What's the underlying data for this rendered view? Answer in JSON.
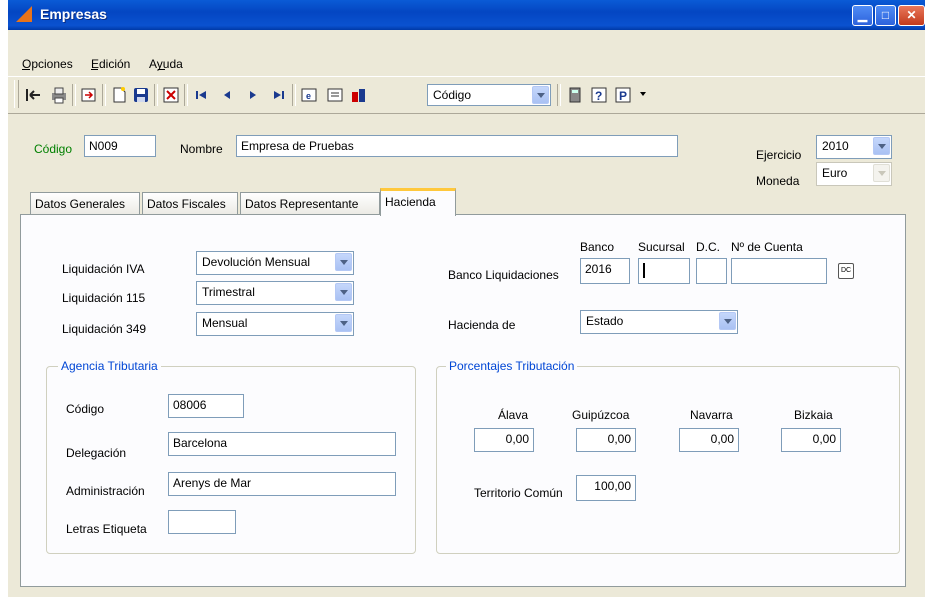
{
  "window": {
    "title": "Empresas"
  },
  "menu": {
    "items": [
      "Opciones",
      "Edición",
      "Ayuda"
    ]
  },
  "toolbar": {
    "search_field_value": "Código"
  },
  "header": {
    "codigo_label": "Código",
    "codigo_value": "N009",
    "nombre_label": "Nombre",
    "nombre_value": "Empresa de Pruebas",
    "ejercicio_label": "Ejercicio",
    "ejercicio_value": "2010",
    "moneda_label": "Moneda",
    "moneda_value": "Euro"
  },
  "tabs": [
    "Datos Generales",
    "Datos Fiscales",
    "Datos Representante",
    "Hacienda"
  ],
  "hacienda": {
    "liq_iva_label": "Liquidación IVA",
    "liq_iva_value": "Devolución Mensual",
    "liq_115_label": "Liquidación 115",
    "liq_115_value": "Trimestral",
    "liq_349_label": "Liquidación 349",
    "liq_349_value": "Mensual",
    "banco_header": "Banco",
    "sucursal_header": "Sucursal",
    "dc_header": "D.C.",
    "cuenta_header": "Nº de Cuenta",
    "banco_liq_label": "Banco Liquidaciones",
    "banco_value": "2016",
    "hacienda_de_label": "Hacienda de",
    "hacienda_de_value": "Estado",
    "dc_icon_text": "DC"
  },
  "agencia": {
    "title": "Agencia Tributaria",
    "codigo_label": "Código",
    "codigo_value": "08006",
    "delegacion_label": "Delegación",
    "delegacion_value": "Barcelona",
    "administracion_label": "Administración",
    "administracion_value": "Arenys de Mar",
    "letras_label": "Letras Etiqueta",
    "letras_value": ""
  },
  "porcentajes": {
    "title": "Porcentajes Tributación",
    "alava_label": "Álava",
    "alava_value": "0,00",
    "guipuzcoa_label": "Guipúzcoa",
    "guipuzcoa_value": "0,00",
    "navarra_label": "Navarra",
    "navarra_value": "0,00",
    "bizkaia_label": "Bizkaia",
    "bizkaia_value": "0,00",
    "territorio_label": "Territorio Común",
    "territorio_value": "100,00"
  },
  "colors": {
    "title_bar": "#0a52d0",
    "group_title": "#0046d5",
    "codigo_label": "#008000",
    "active_tab_highlight": "#ffc83c"
  }
}
